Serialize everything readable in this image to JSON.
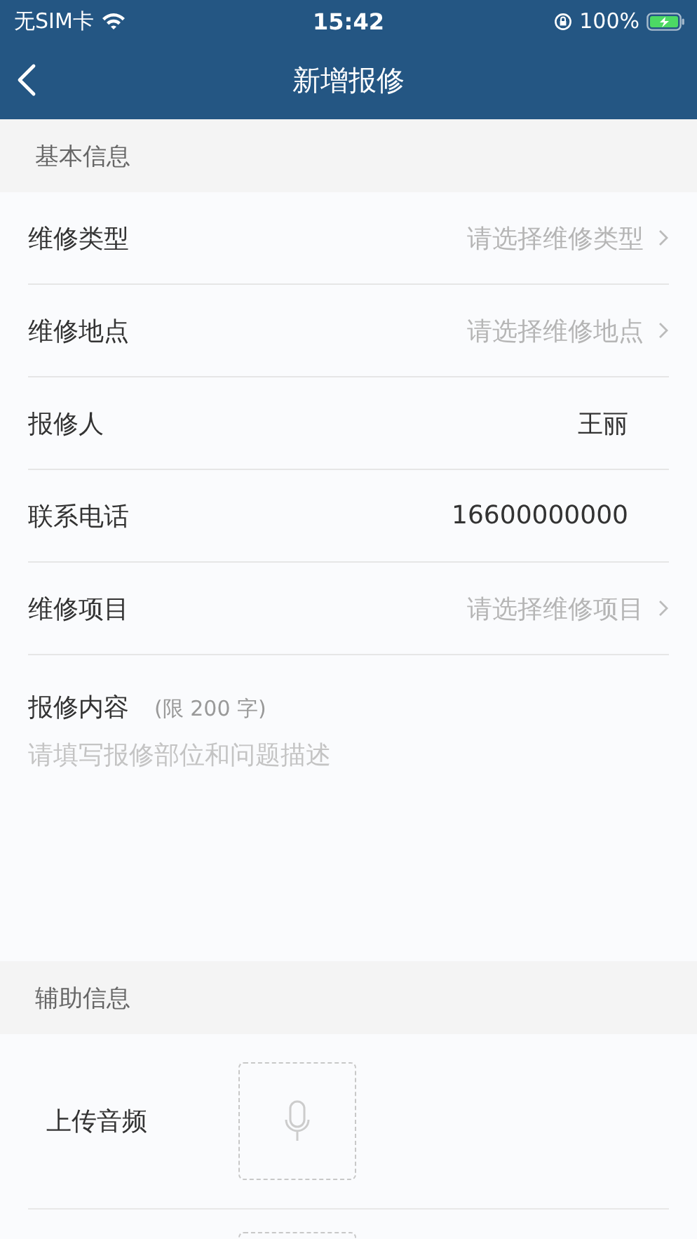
{
  "status_bar": {
    "carrier": "无SIM卡",
    "time": "15:42",
    "battery": "100%"
  },
  "nav": {
    "title": "新增报修"
  },
  "sections": [
    {
      "title": "基本信息",
      "rows": [
        {
          "label": "维修类型",
          "kind": "select",
          "placeholder": "请选择维修类型"
        },
        {
          "label": "维修地点",
          "kind": "select",
          "placeholder": "请选择维修地点"
        },
        {
          "label": "报修人",
          "kind": "value",
          "value": "王丽"
        },
        {
          "label": "联系电话",
          "kind": "value",
          "value": "16600000000"
        },
        {
          "label": "维修项目",
          "kind": "select",
          "placeholder": "请选择维修项目"
        }
      ],
      "content": {
        "label": "报修内容",
        "hint": "(限 200 字)",
        "placeholder": "请填写报修部位和问题描述"
      }
    },
    {
      "title": "辅助信息",
      "uploads": [
        {
          "label": "上传音频",
          "kind": "audio"
        },
        {
          "kind": "blank"
        }
      ]
    }
  ]
}
